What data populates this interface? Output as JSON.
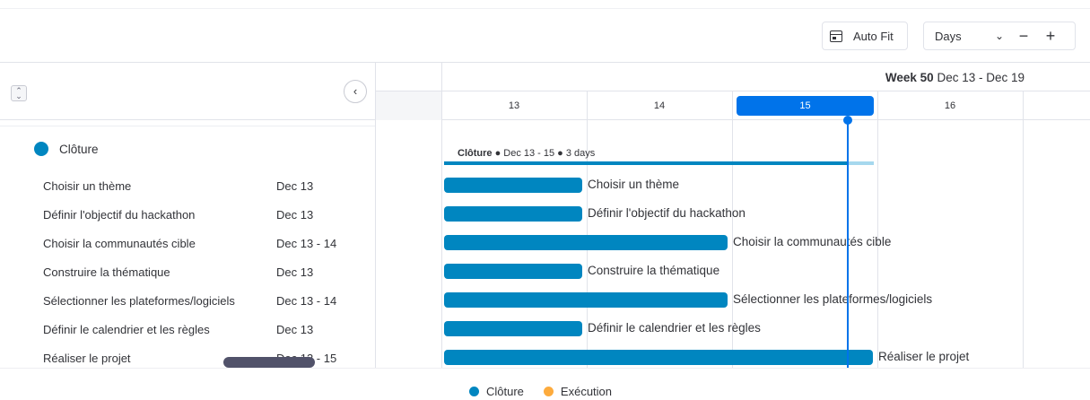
{
  "toolbar": {
    "autofit_label": "Auto Fit",
    "zoom_select": "Days",
    "zoom_out": "−",
    "zoom_in": "+"
  },
  "timeline": {
    "week_bold": "Week 50",
    "week_range": "Dec 13 - Dec 19",
    "days": [
      "13",
      "14",
      "15",
      "16"
    ],
    "current_day": "15"
  },
  "group": {
    "name": "Clôture",
    "color": "#0086c0",
    "summary_name": "Clôture",
    "summary_detail": "● Dec 13 - 15 ● 3 days"
  },
  "tasks": [
    {
      "name": "Choisir un thème",
      "date": "Dec 13",
      "days": 1
    },
    {
      "name": "Définir l'objectif du hackathon",
      "date": "Dec 13",
      "days": 1
    },
    {
      "name": "Choisir la communautés cible",
      "date": "Dec 13 - 14",
      "days": 2
    },
    {
      "name": "Construire la thématique",
      "date": "Dec 13",
      "days": 1
    },
    {
      "name": "Sélectionner les plateformes/logiciels",
      "date": "Dec 13 - 14",
      "days": 2
    },
    {
      "name": "Définir le calendrier et les règles",
      "date": "Dec 13",
      "days": 1
    },
    {
      "name": "Réaliser le projet",
      "date": "Dec 13 - 15",
      "days": 3
    }
  ],
  "legend": [
    {
      "label": "Clôture",
      "color": "#0086c0"
    },
    {
      "label": "Exécution",
      "color": "#fdab3d"
    }
  ],
  "colors": {
    "accent": "#0073ea",
    "bar": "#0086c0"
  }
}
